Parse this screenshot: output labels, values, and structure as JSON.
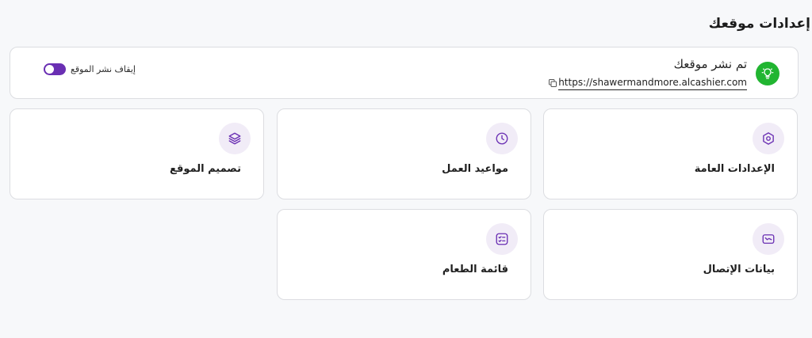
{
  "page": {
    "title": "إعدادات موقعك"
  },
  "publish": {
    "status_title": "تم نشر موقعك",
    "url": "https://shawermandmore.alcashier.com",
    "toggle_label": "إيقاف نشر الموقع",
    "toggle_on": true,
    "badge_color": "#21b531",
    "accent_color": "#6a2fb3"
  },
  "tiles": [
    {
      "label": "الإعدادات العامة",
      "icon": "settings-hexagon-icon"
    },
    {
      "label": "مواعيد العمل",
      "icon": "clock-icon"
    },
    {
      "label": "تصميم الموقع",
      "icon": "layers-icon"
    },
    {
      "label": "بيانات الإتصال",
      "icon": "mail-icon"
    },
    {
      "label": "قائمة الطعام",
      "icon": "menu-list-icon"
    }
  ]
}
